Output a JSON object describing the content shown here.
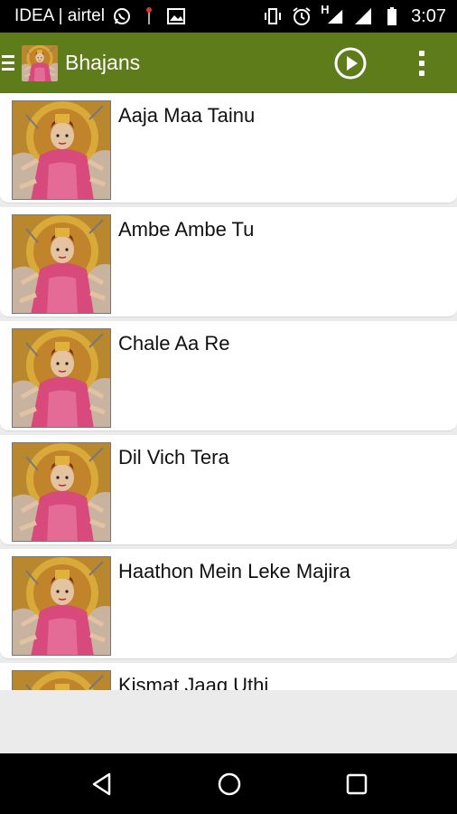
{
  "status_bar": {
    "carrier": "IDEA | airtel",
    "time": "3:07",
    "network_type": "H",
    "icons": [
      "whatsapp-icon",
      "notification-icon",
      "gallery-icon",
      "vibrate-icon",
      "alarm-icon",
      "signal-icon",
      "signal-icon",
      "battery-icon"
    ]
  },
  "app_bar": {
    "title": "Bhajans",
    "accent_color": "#5e7c1a"
  },
  "songs": [
    {
      "title": "Aaja Maa Tainu"
    },
    {
      "title": "Ambe Ambe Tu"
    },
    {
      "title": "Chale Aa Re"
    },
    {
      "title": "Dil Vich Tera"
    },
    {
      "title": "Haathon Mein Leke Majira"
    },
    {
      "title": "Kismat Jaag Uthi"
    }
  ],
  "nav_bar": {
    "buttons": [
      "back-icon",
      "home-icon",
      "recents-icon"
    ]
  }
}
